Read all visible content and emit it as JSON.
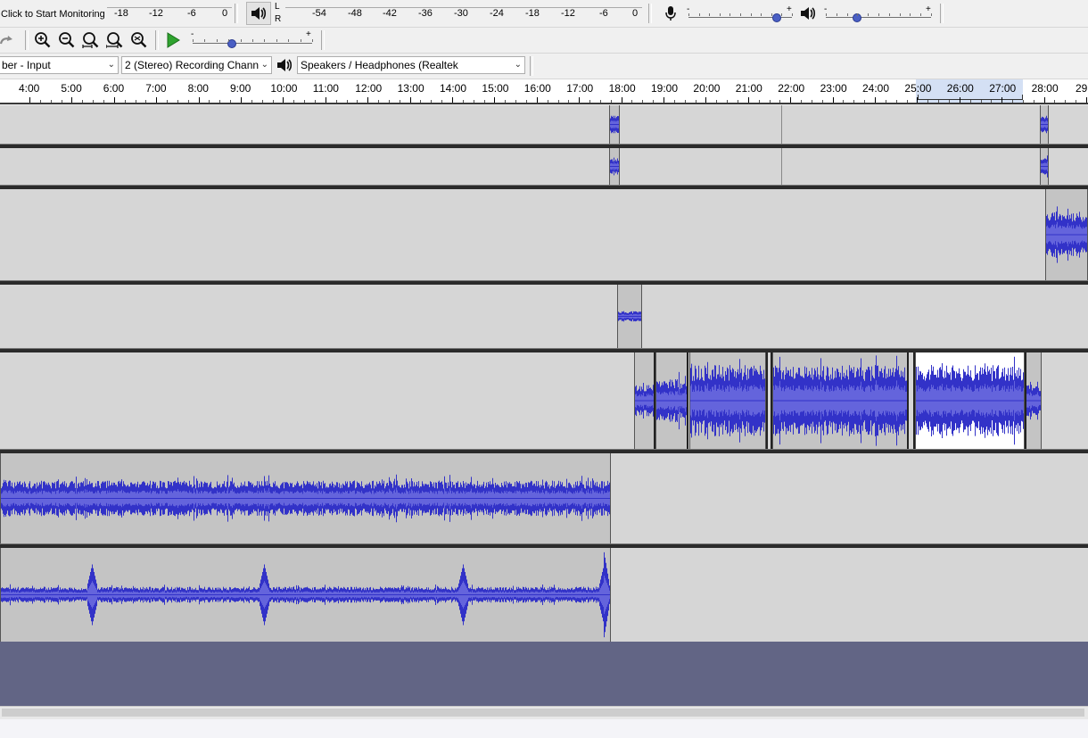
{
  "meter_toolbar": {
    "record_meter_prompt": "Click to Start Monitoring",
    "record_ticks": [
      "-18",
      "-12",
      "-6",
      "0"
    ],
    "playback_channels": [
      "L",
      "R"
    ],
    "playback_ticks": [
      "-54",
      "-48",
      "-42",
      "-36",
      "-30",
      "-24",
      "-18",
      "-12",
      "-6",
      "0"
    ]
  },
  "mixer_toolbar": {
    "recording_volume_icon": "microphone-icon",
    "playback_volume_icon": "speaker-icon",
    "recording_level": 0.85,
    "playback_level": 0.3,
    "minus": "-",
    "plus": "+"
  },
  "edit_toolbar": {
    "icons": [
      "redo-icon",
      "zoom-in-icon",
      "zoom-out-icon",
      "fit-selection-icon",
      "fit-project-icon",
      "zoom-toggle-icon"
    ],
    "play_at_speed_icon": "play-at-speed-icon",
    "speed_level": 0.33,
    "minus": "-",
    "plus": "+"
  },
  "device_toolbar": {
    "recording_device": "ber - Input",
    "recording_channels": "2 (Stereo) Recording Chann",
    "playback_icon": "speaker-icon",
    "playback_device": "Speakers / Headphones (Realtek"
  },
  "timeline": {
    "labels": [
      "4:00",
      "5:00",
      "6:00",
      "7:00",
      "8:00",
      "9:00",
      "10:00",
      "11:00",
      "12:00",
      "13:00",
      "14:00",
      "15:00",
      "16:00",
      "17:00",
      "18:00",
      "19:00",
      "20:00",
      "21:00",
      "22:00",
      "23:00",
      "24:00",
      "25:00",
      "26:00",
      "27:00",
      "28:00",
      "29:"
    ]
  },
  "colors": {
    "waveform": "#3232c8",
    "waveform_rms": "#6464dc",
    "clip_bg": "#c4c4c4",
    "selected_clip_bg": "#ffffff",
    "track_bg": "#d6d6d6",
    "empty_area": "#626585"
  }
}
